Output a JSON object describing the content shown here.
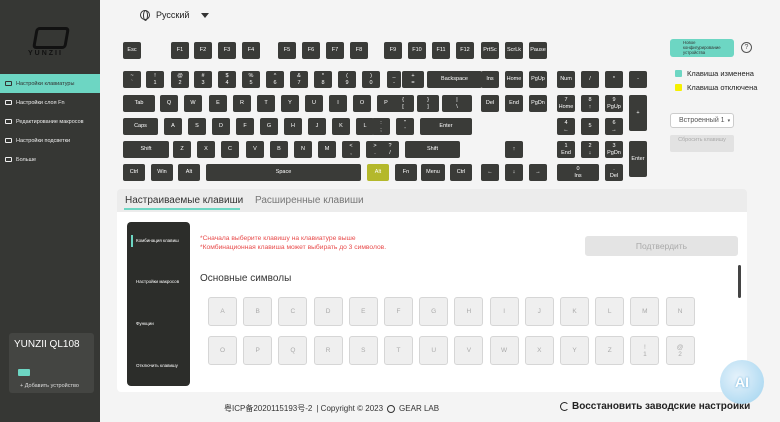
{
  "brand": {
    "logo_text": "YUNZII"
  },
  "sidebar": {
    "items": [
      {
        "label": "Настройки клавиатуры",
        "active": true
      },
      {
        "label": "Настройки слоя Fn",
        "active": false
      },
      {
        "label": "Редактирование макросов",
        "active": false
      },
      {
        "label": "Настройки подсветки",
        "active": false
      },
      {
        "label": "Больше",
        "active": false
      }
    ],
    "device_name": "YUNZII QL108",
    "add_device": "+ Добавить устройство"
  },
  "topbar": {
    "language": "Русский"
  },
  "keyboard": {
    "rows": [
      [
        "Esc",
        "F1",
        "F2",
        "F3",
        "F4",
        "F5",
        "F6",
        "F7",
        "F8",
        "F9",
        "F10",
        "F11",
        "F12",
        "PrtSc",
        "ScrLk",
        "Pause"
      ],
      [
        "~\n`",
        "!\n1",
        "@\n2",
        "#\n3",
        "$\n4",
        "%\n5",
        "^\n6",
        "&\n7",
        "*\n8",
        "(\n9",
        ")\n0",
        "_\n-",
        "+\n=",
        "Backspace",
        "Ins",
        "Home",
        "PgUp",
        "Num",
        "/",
        "*",
        "-"
      ],
      [
        "Tab",
        "Q",
        "W",
        "E",
        "R",
        "T",
        "Y",
        "U",
        "I",
        "O",
        "P",
        "{\n[",
        "}\n]",
        "|\n\\",
        "Del",
        "End",
        "PgDn",
        "7\nHome",
        "8\n↑",
        "9\nPgUp",
        "+"
      ],
      [
        "Caps",
        "A",
        "S",
        "D",
        "F",
        "G",
        "H",
        "J",
        "K",
        "L",
        ":\n;",
        "\"\n'",
        "Enter",
        "4\n←",
        "5",
        "6\n→"
      ],
      [
        "Shift",
        "Z",
        "X",
        "C",
        "V",
        "B",
        "N",
        "M",
        "<\n,",
        ">\n.",
        "?\n/",
        "Shift",
        "↑",
        "1\nEnd",
        "2\n↓",
        "3\nPgDn",
        "Enter"
      ],
      [
        "Ctrl",
        "Win",
        "Alt",
        "Space",
        "Alt",
        "Fn",
        "Menu",
        "Ctrl",
        "←",
        "↓",
        "→",
        "0\nIns",
        ".\nDel"
      ]
    ],
    "highlighted": "Alt"
  },
  "right_panel": {
    "layout_button": "Новое конфигурирование устройства",
    "help": "?",
    "legend": [
      {
        "label": "Клавиша изменена",
        "color": "#6dd6c3"
      },
      {
        "label": "Клавиша отключена",
        "color": "#f5f000"
      }
    ],
    "preset": "Встроенный 1",
    "reset_key": "Сбросить клавишу"
  },
  "tabs": {
    "active": "Настраиваемые клавиши",
    "inactive": "Расширенные клавиши"
  },
  "panel": {
    "menu": [
      "Комбинация клавиш",
      "Настройки макросов",
      "Функции",
      "Отключить клавишу"
    ],
    "note1": "*Сначала выберите клавишу на клавиатуре выше",
    "note2": "*Комбинационная клавиша может выбирать до 3 символов.",
    "confirm": "Подтвердить",
    "section_title": "Основные символы",
    "symbols_row1": [
      "A",
      "B",
      "C",
      "D",
      "E",
      "F",
      "G",
      "H",
      "I",
      "J",
      "K",
      "L",
      "M",
      "N"
    ],
    "symbols_row2": [
      "O",
      "P",
      "Q",
      "R",
      "S",
      "T",
      "U",
      "V",
      "W",
      "X",
      "Y",
      "Z",
      "!\n1",
      "@\n2",
      "#\n3",
      "$\n4"
    ]
  },
  "footer": {
    "icp": "粤ICP备2020115193号-2",
    "copyright": "| Copyright © 2023",
    "company": "GEAR LAB",
    "factory_reset": "Восстановить заводские настройки"
  },
  "badge": "AI"
}
